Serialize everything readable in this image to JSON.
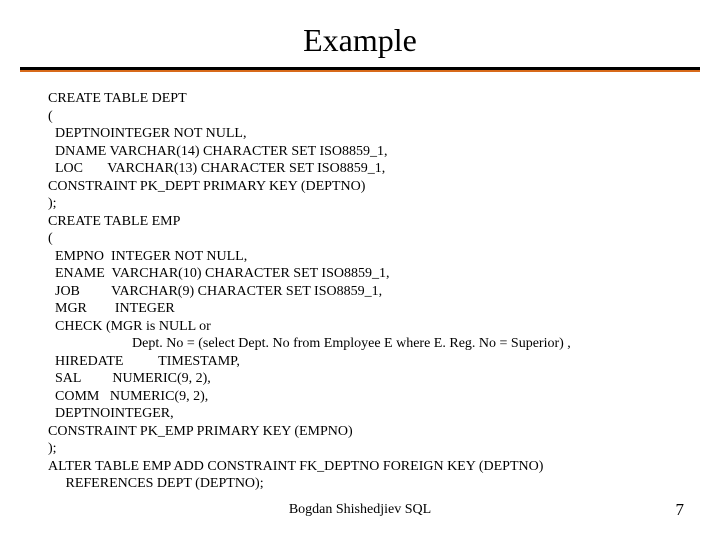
{
  "title": "Example",
  "code": "CREATE TABLE DEPT\n(\n  DEPTNOINTEGER NOT NULL,\n  DNAME VARCHAR(14) CHARACTER SET ISO8859_1,\n  LOC       VARCHAR(13) CHARACTER SET ISO8859_1,\nCONSTRAINT PK_DEPT PRIMARY KEY (DEPTNO)\n);\nCREATE TABLE EMP\n(\n  EMPNO  INTEGER NOT NULL,\n  ENAME  VARCHAR(10) CHARACTER SET ISO8859_1,\n  JOB         VARCHAR(9) CHARACTER SET ISO8859_1,\n  MGR        INTEGER\n  CHECK (MGR is NULL or\n                        Dept. No = (select Dept. No from Employee E where E. Reg. No = Superior) ,\n  HIREDATE          TIMESTAMP,\n  SAL         NUMERIC(9, 2),\n  COMM   NUMERIC(9, 2),\n  DEPTNOINTEGER,\nCONSTRAINT PK_EMP PRIMARY KEY (EMPNO)\n);\nALTER TABLE EMP ADD CONSTRAINT FK_DEPTNO FOREIGN KEY (DEPTNO)\n     REFERENCES DEPT (DEPTNO);",
  "footer_center": "Bogdan Shishedjiev SQL",
  "footer_right": "7"
}
